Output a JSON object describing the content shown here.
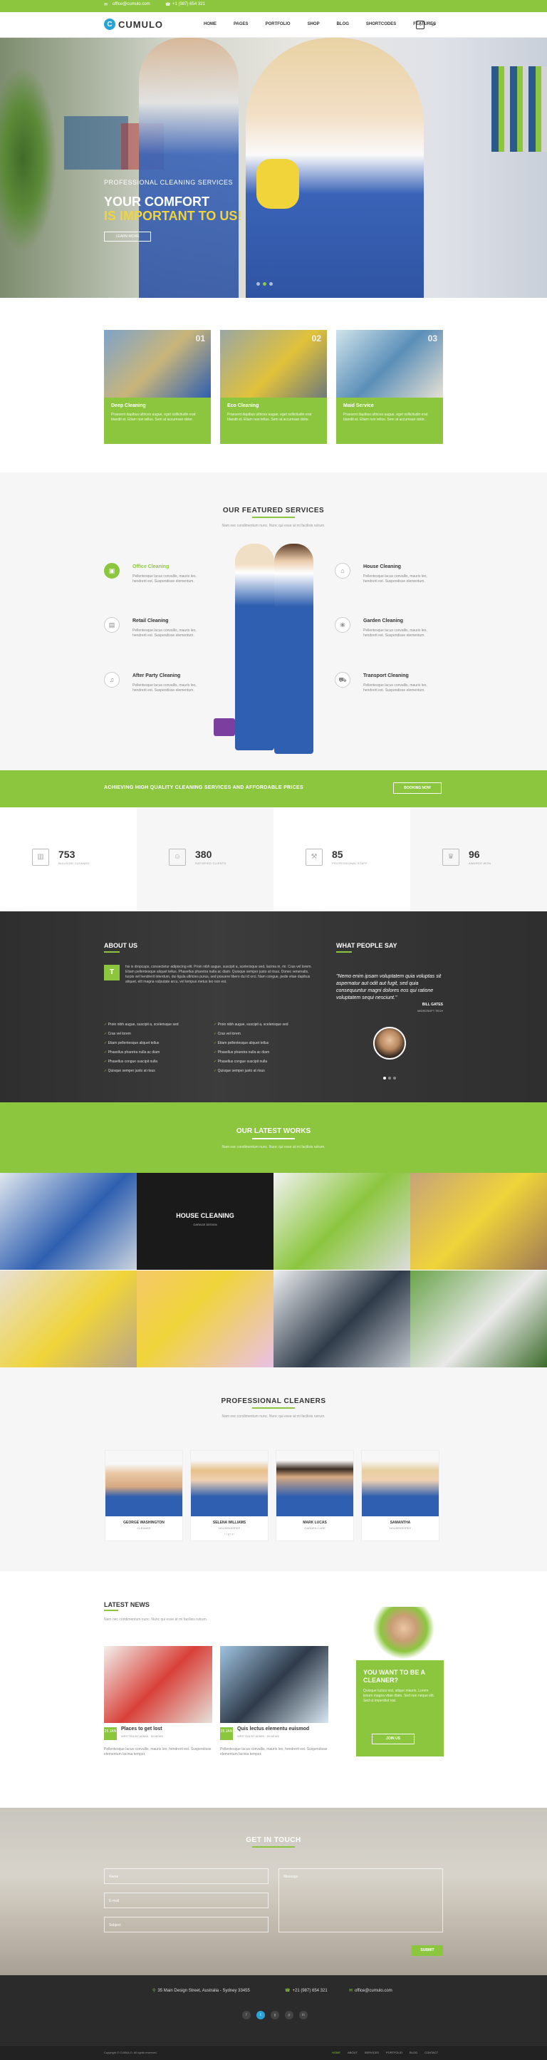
{
  "topbar": {
    "email": "office@cumulo.com",
    "phone": "+1 (987) 654 321"
  },
  "nav": {
    "logo_letter": "C",
    "logo_text": "CUMULO",
    "items": [
      "HOME",
      "PAGES",
      "PORTFOLIO",
      "SHOP",
      "BLOG",
      "SHORTCODES",
      "FEATURES"
    ],
    "cart_count": "0"
  },
  "hero": {
    "subtitle": "PROFESSIONAL CLEANING SERVICES",
    "title_line1": "YOUR COMFORT",
    "title_line2": "IS IMPORTANT TO US!",
    "button": "LEARN MORE"
  },
  "cards": [
    {
      "num": "01",
      "title": "Deep Cleaning",
      "text": "Praesent dapibus ultrices augue, eget sollicitudin erat blandit et. Etiam non tellus. Sem at accumsan dolor."
    },
    {
      "num": "02",
      "title": "Eco Cleaning",
      "text": "Praesent dapibus ultrices augue, eget sollicitudin erat blandit et. Etiam non tellus. Sem at accumsan dolor."
    },
    {
      "num": "03",
      "title": "Maid Service",
      "text": "Praesent dapibus ultrices augue, eget sollicitudin erat blandit et. Etiam non tellus. Sem at accumsan dolor."
    }
  ],
  "featured": {
    "title": "OUR FEATURED SERVICES",
    "subtitle": "Nam nec condimentum nunc. Nunc qui esse at mi facilisis rutrum.",
    "items": [
      {
        "title": "Office Cleaning",
        "text": "Pellentesque lacus convallis, mauris leo, hendrerit est. Suspendisse elementum."
      },
      {
        "title": "Retail Cleaning",
        "text": "Pellentesque lacus convallis, mauris leo, hendrerit est. Suspendisse elementum."
      },
      {
        "title": "After Party Cleaning",
        "text": "Pellentesque lacus convallis, mauris leo, hendrerit est. Suspendisse elementum."
      },
      {
        "title": "House Cleaning",
        "text": "Pellentesque lacus convallis, mauris leo, hendrerit est. Suspendisse elementum."
      },
      {
        "title": "Garden Cleaning",
        "text": "Pellentesque lacus convallis, mauris leo, hendrerit est. Suspendisse elementum."
      },
      {
        "title": "Transport Cleaning",
        "text": "Pellentesque lacus convallis, mauris leo, hendrerit est. Suspendisse elementum."
      }
    ]
  },
  "banner": {
    "text": "ACHIEVING HIGH QUALITY CLEANING SERVICES AND AFFORDABLE PRICES",
    "button": "BOOKING NOW"
  },
  "stats": [
    {
      "num": "753",
      "label": "BUILDING CLEANED"
    },
    {
      "num": "380",
      "label": "SATISFIED CLIENTS"
    },
    {
      "num": "85",
      "label": "PROFESSIONAL STAFF"
    },
    {
      "num": "96",
      "label": "AWARDS WON"
    }
  ],
  "about": {
    "title": "ABOUT US",
    "drop": "T",
    "text": "his is dropcaps, consectetur adipiscing elit. Proin nibh augue, suscipit a, scelerisque sed, lacinia in, mi. Cras vel lorem. Etiam pellentesque aliquet tellus. Phasellus pharetra nulla ac diam. Quisque semper justo at risus. Donec venenatis, turpis vel hendrerit interdum, dui ligula ultricies purus, sed posuere libero dui id orci. Nam congue, pede vitae dapibus aliquet, elit magna vulputate arcu, vel tempus metus leo non est.",
    "list": [
      "Proin nibh augue, suscipit a, scelerisque sed",
      "Cras vel lorem",
      "Etiam pellentesque aliquet tellus",
      "Phasellus pharetra nulla ac diam",
      "Phasellus congue suscipit nulla",
      "Quisque semper justo at risus",
      "Proin nibh augue, suscipit a, scelerisque sed",
      "Cras vel lorem",
      "Etiam pellentesque aliquet tellus",
      "Phasellus pharetra nulla ac diam",
      "Phasellus congue suscipit nulla",
      "Quisque semper justo at risus"
    ]
  },
  "testimonial": {
    "title": "WHAT PEOPLE SAY",
    "quote": "\"Nemo enim ipsam voluptatem quia voluptas sit aspernatur aut odit aut fugit, sed quia consequuntur magni dolores eos qui ratione voluptatem sequi nesciunt.\"",
    "name": "BILL GATES",
    "role": "MICROSOFT TECH"
  },
  "works": {
    "title": "OUR LATEST WORKS",
    "subtitle": "Nam nec condimentum nunc. Nunc qui esse at mi facilisis rutrum.",
    "highlight_title": "HOUSE CLEANING",
    "highlight_sub": "GARAGE DESIGN"
  },
  "team": {
    "title": "PROFESSIONAL CLEANERS",
    "subtitle": "Nam nec condimentum nunc. Nunc qui esse at mi facilisis rutrum.",
    "members": [
      {
        "name": "GEORGE WASHINGTON",
        "role": "CLEANER"
      },
      {
        "name": "SELENA WILLIAMS",
        "role": "HOUSEKEEPER"
      },
      {
        "name": "MARK LUCAS",
        "role": "GARDEN CARE"
      },
      {
        "name": "SAMANTHA",
        "role": "HOUSEKEEPER"
      }
    ],
    "social": "f  t  g+  in"
  },
  "news": {
    "title": "LATEST NEWS",
    "subtitle": "Nam nec condimentum nunc. Nunc qui esse at mi facilisis rutrum.",
    "posts": [
      {
        "date": "25 JAN",
        "title": "Places to get lost",
        "meta": "WRITTEN BY ADMIN  ·  IN NEWS",
        "text": "Pellentesque lacus convallis, mauris leo, hendrerit est. Suspendisse elementum lacinia tempor."
      },
      {
        "date": "25 JAN",
        "title": "Quis lectus elementu euismod",
        "meta": "WRITTEN BY ADMIN  ·  IN NEWS",
        "text": "Pellentesque lacus convallis, mauris leo, hendrerit est. Suspendisse elementum lacinia tempor."
      }
    ],
    "promo_title": "YOU WANT TO BE A CLEANER?",
    "promo_text": "Quisque luctus nisl, alique mauris. Lorem ipsum magna vitae diam. Sed non neque elit. Sed ut imperdiet nisi.",
    "promo_button": "JOIN US"
  },
  "contact": {
    "title": "GET IN TOUCH",
    "name": "Name",
    "email": "E-mail",
    "subject": "Subject",
    "message": "Message",
    "submit": "SUBMIT"
  },
  "footer": {
    "address": "35 Main Design Street, Australia - Sydney 33455",
    "phone": "+21 (987) 654 321",
    "email": "office@cumulo.com",
    "copyright": "Copyright © CUMULO. All rights reserved.",
    "nav": [
      "HOME",
      "ABOUT",
      "SERVICES",
      "PORTFOLIO",
      "BLOG",
      "CONTACT"
    ]
  },
  "colors": {
    "accent": "#8cc63f",
    "blue": "#29a3d6",
    "dark": "#2b2b2b"
  }
}
